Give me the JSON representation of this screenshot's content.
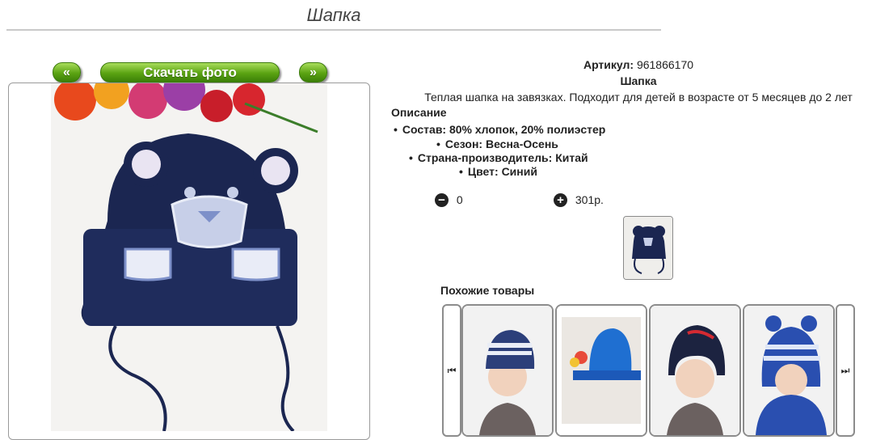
{
  "page": {
    "title": "Шапка"
  },
  "photo_nav": {
    "prev_label": "«",
    "download_label": "Скачать фото",
    "next_label": "»"
  },
  "product": {
    "article_label": "Артикул:",
    "article_value": "961866170",
    "name": "Шапка",
    "description_text": "Теплая шапка на завязках. Подходит для детей в возрасте от 5 месяцев до 2 лет",
    "description_label": "Описание",
    "properties": [
      "Состав: 80% хлопок, 20% полиэстер",
      "Сезон: Весна-Осень",
      "Страна-производитель: Китай",
      "Цвет: Синий"
    ]
  },
  "cart": {
    "minus_icon": "minus-icon",
    "quantity": "0",
    "plus_icon": "plus-icon",
    "price": "301р."
  },
  "similar": {
    "label": "Похожие товары",
    "prev_icon": "skip-prev-icon",
    "next_icon": "skip-next-icon"
  },
  "colors": {
    "button_green": "#5aa312",
    "hat_navy": "#1b2651"
  }
}
